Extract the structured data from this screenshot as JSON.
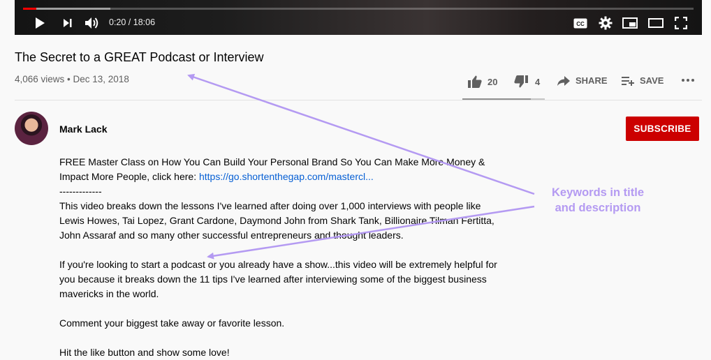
{
  "player": {
    "current_time": "0:20",
    "duration": "18:06",
    "time_display": "0:20 / 18:06",
    "progress_played": 0.02
  },
  "video": {
    "title": "The Secret to a GREAT Podcast or Interview",
    "views": "4,066 views",
    "date": "Dec 13, 2018",
    "meta_line": "4,066 views • Dec 13, 2018"
  },
  "actions": {
    "likes": "20",
    "dislikes": "4",
    "share_label": "SHARE",
    "save_label": "SAVE",
    "like_ratio": 0.83
  },
  "channel": {
    "name": "Mark Lack",
    "subscribe_label": "SUBSCRIBE"
  },
  "description": {
    "p1_text": "FREE Master Class on How You Can Build Your Personal Brand So You Can Make More Money & Impact More People, click here: ",
    "p1_link": "https://go.shortenthegap.com/mastercl...",
    "separator": "-------------",
    "p2": "This video breaks down the lessons I've learned after doing over 1,000 interviews with people like Lewis Howes, Tai Lopez, Grant Cardone, Daymond John from Shark Tank, Billionaire Tilman Fertitta, John Assaraf and so many other successful entrepreneurs and thought leaders.",
    "p3": "If you're looking to start a podcast or you already have a show...this video will be extremely helpful for you because it breaks down the 11 tips I've learned after interviewing some of the biggest business mavericks in the world.",
    "p4": "Comment your biggest take away or favorite lesson.",
    "p5": "Hit the like button and show some love!"
  },
  "annotation": {
    "line1": "Keywords in title",
    "line2": "and description",
    "color": "#b49af2"
  },
  "colors": {
    "subscribe": "#cc0000",
    "link": "#065fd4",
    "progress": "#ff0000"
  }
}
